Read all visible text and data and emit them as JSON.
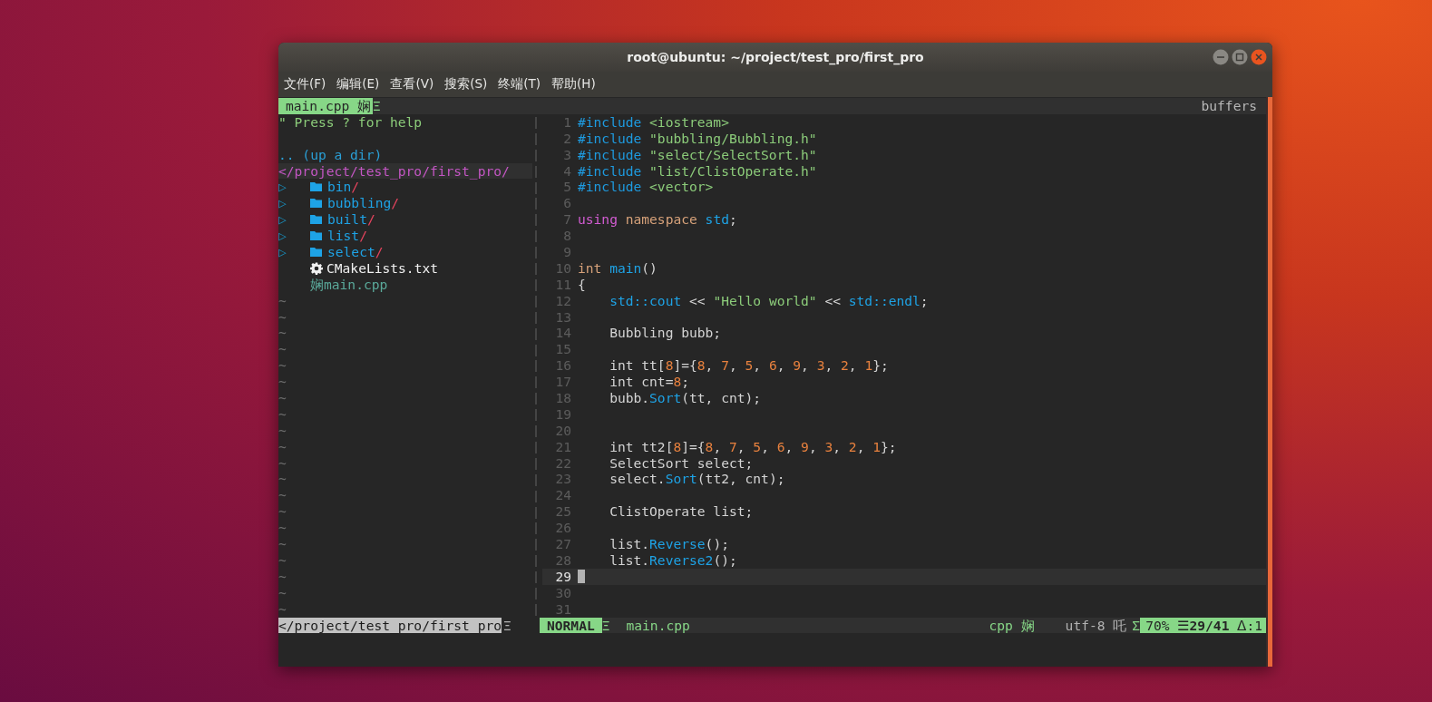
{
  "window": {
    "title": "root@ubuntu: ~/project/test_pro/first_pro"
  },
  "menu": [
    "文件(F)",
    "编辑(E)",
    "查看(V)",
    "搜索(S)",
    "终端(T)",
    "帮助(H)"
  ],
  "tabline": {
    "tab": {
      "label": "main.cpp",
      "glyph": "娴",
      "selected": true
    },
    "separator": "Ξ",
    "right": "buffers"
  },
  "tree": {
    "help": "\" Press ? for help",
    "updir": ".. (up a dir)",
    "cwd": "</project/test_pro/first_pro/",
    "entries": [
      {
        "kind": "dir",
        "arrow": "▷",
        "name": "bin",
        "suffix": "/"
      },
      {
        "kind": "dir",
        "arrow": "▷",
        "name": "bubbling",
        "suffix": "/"
      },
      {
        "kind": "dir",
        "arrow": "▷",
        "name": "built",
        "suffix": "/"
      },
      {
        "kind": "dir",
        "arrow": "▷",
        "name": "list",
        "suffix": "/"
      },
      {
        "kind": "dir",
        "arrow": "▷",
        "name": "select",
        "suffix": "/"
      },
      {
        "kind": "config",
        "name": "CMakeLists.txt"
      },
      {
        "kind": "file",
        "glyph": "娴",
        "name": "main.cpp"
      }
    ],
    "fillers": [
      "~",
      "~",
      "~",
      "~",
      "~",
      "~",
      "~",
      "~",
      "~",
      "~",
      "~",
      "~",
      "~",
      "~",
      "~",
      "~",
      "~",
      "~",
      "~",
      "~"
    ]
  },
  "code": {
    "lines": [
      {
        "n": "1",
        "current": false,
        "tokens": [
          {
            "kind": "pre",
            "text": "#include "
          },
          {
            "kind": "str",
            "text": "<iostream>"
          }
        ]
      },
      {
        "n": "2",
        "current": false,
        "tokens": [
          {
            "kind": "pre",
            "text": "#include "
          },
          {
            "kind": "str",
            "text": "\"bubbling/Bubbling.h\""
          }
        ]
      },
      {
        "n": "3",
        "current": false,
        "tokens": [
          {
            "kind": "pre",
            "text": "#include "
          },
          {
            "kind": "str",
            "text": "\"select/SelectSort.h\""
          }
        ]
      },
      {
        "n": "4",
        "current": false,
        "tokens": [
          {
            "kind": "pre",
            "text": "#include "
          },
          {
            "kind": "str",
            "text": "\"list/ClistOperate.h\""
          }
        ]
      },
      {
        "n": "5",
        "current": false,
        "tokens": [
          {
            "kind": "pre",
            "text": "#include "
          },
          {
            "kind": "str",
            "text": "<vector>"
          }
        ]
      },
      {
        "n": "6",
        "current": false
      },
      {
        "n": "7",
        "current": false,
        "tokens": [
          {
            "kind": "kw",
            "text": "using "
          },
          {
            "kind": "type",
            "text": "namespace "
          },
          {
            "kind": "fn",
            "text": "std"
          },
          {
            "kind": "plain",
            "text": ";"
          }
        ]
      },
      {
        "n": "8",
        "current": false
      },
      {
        "n": "9",
        "current": false
      },
      {
        "n": "10",
        "current": false,
        "tokens": [
          {
            "kind": "type",
            "text": "int "
          },
          {
            "kind": "fn",
            "text": "main"
          },
          {
            "kind": "plain",
            "text": "()"
          }
        ]
      },
      {
        "n": "11",
        "current": false,
        "tokens": [
          {
            "kind": "plain",
            "text": "{"
          }
        ]
      },
      {
        "n": "12",
        "current": false,
        "tokens": [
          {
            "kind": "fn",
            "text": "    std::cout"
          },
          {
            "kind": "plain",
            "text": " << "
          },
          {
            "kind": "str",
            "text": "\"Hello world\""
          },
          {
            "kind": "plain",
            "text": " << "
          },
          {
            "kind": "fn",
            "text": "std::endl"
          },
          {
            "kind": "plain",
            "text": ";"
          }
        ]
      },
      {
        "n": "13",
        "current": false
      },
      {
        "n": "14",
        "current": false,
        "tokens": [
          {
            "kind": "plain",
            "text": "    Bubbling bubb;"
          }
        ]
      },
      {
        "n": "15",
        "current": false
      },
      {
        "n": "16",
        "current": false,
        "tokens": [
          {
            "kind": "plain",
            "text": "    int tt["
          },
          {
            "kind": "num",
            "text": "8"
          },
          {
            "kind": "plain",
            "text": "]={"
          },
          {
            "kind": "num",
            "text": "8"
          },
          {
            "kind": "plain",
            "text": ", "
          },
          {
            "kind": "num",
            "text": "7"
          },
          {
            "kind": "plain",
            "text": ", "
          },
          {
            "kind": "num",
            "text": "5"
          },
          {
            "kind": "plain",
            "text": ", "
          },
          {
            "kind": "num",
            "text": "6"
          },
          {
            "kind": "plain",
            "text": ", "
          },
          {
            "kind": "num",
            "text": "9"
          },
          {
            "kind": "plain",
            "text": ", "
          },
          {
            "kind": "num",
            "text": "3"
          },
          {
            "kind": "plain",
            "text": ", "
          },
          {
            "kind": "num",
            "text": "2"
          },
          {
            "kind": "plain",
            "text": ", "
          },
          {
            "kind": "num",
            "text": "1"
          },
          {
            "kind": "plain",
            "text": "};"
          }
        ]
      },
      {
        "n": "17",
        "current": false,
        "tokens": [
          {
            "kind": "plain",
            "text": "    int cnt="
          },
          {
            "kind": "num",
            "text": "8"
          },
          {
            "kind": "plain",
            "text": ";"
          }
        ]
      },
      {
        "n": "18",
        "current": false,
        "tokens": [
          {
            "kind": "plain",
            "text": "    bubb."
          },
          {
            "kind": "fn",
            "text": "Sort"
          },
          {
            "kind": "plain",
            "text": "(tt, cnt);"
          }
        ]
      },
      {
        "n": "19",
        "current": false
      },
      {
        "n": "20",
        "current": false
      },
      {
        "n": "21",
        "current": false,
        "tokens": [
          {
            "kind": "plain",
            "text": "    int tt2["
          },
          {
            "kind": "num",
            "text": "8"
          },
          {
            "kind": "plain",
            "text": "]={"
          },
          {
            "kind": "num",
            "text": "8"
          },
          {
            "kind": "plain",
            "text": ", "
          },
          {
            "kind": "num",
            "text": "7"
          },
          {
            "kind": "plain",
            "text": ", "
          },
          {
            "kind": "num",
            "text": "5"
          },
          {
            "kind": "plain",
            "text": ", "
          },
          {
            "kind": "num",
            "text": "6"
          },
          {
            "kind": "plain",
            "text": ", "
          },
          {
            "kind": "num",
            "text": "9"
          },
          {
            "kind": "plain",
            "text": ", "
          },
          {
            "kind": "num",
            "text": "3"
          },
          {
            "kind": "plain",
            "text": ", "
          },
          {
            "kind": "num",
            "text": "2"
          },
          {
            "kind": "plain",
            "text": ", "
          },
          {
            "kind": "num",
            "text": "1"
          },
          {
            "kind": "plain",
            "text": "};"
          }
        ]
      },
      {
        "n": "22",
        "current": false,
        "tokens": [
          {
            "kind": "plain",
            "text": "    SelectSort select;"
          }
        ]
      },
      {
        "n": "23",
        "current": false,
        "tokens": [
          {
            "kind": "plain",
            "text": "    select."
          },
          {
            "kind": "fn",
            "text": "Sort"
          },
          {
            "kind": "plain",
            "text": "(tt2, cnt);"
          }
        ]
      },
      {
        "n": "24",
        "current": false
      },
      {
        "n": "25",
        "current": false,
        "tokens": [
          {
            "kind": "plain",
            "text": "    ClistOperate list;"
          }
        ]
      },
      {
        "n": "26",
        "current": false
      },
      {
        "n": "27",
        "current": false,
        "tokens": [
          {
            "kind": "plain",
            "text": "    list."
          },
          {
            "kind": "fn",
            "text": "Reverse"
          },
          {
            "kind": "plain",
            "text": "();"
          }
        ]
      },
      {
        "n": "28",
        "current": false,
        "tokens": [
          {
            "kind": "plain",
            "text": "    list."
          },
          {
            "kind": "fn",
            "text": "Reverse2"
          },
          {
            "kind": "plain",
            "text": "();"
          }
        ]
      },
      {
        "n": "29",
        "current": true
      },
      {
        "n": "30",
        "current": false
      },
      {
        "n": "31",
        "current": false
      }
    ]
  },
  "statusline": {
    "path": "</project/test_pro/first_pro",
    "path_separator": "Ξ",
    "mode": "NORMAL",
    "mode_separator": "Ξ",
    "filename": "main.cpp",
    "filetype": "cpp 娴",
    "encoding": "utf-8 吒",
    "segment_separator": "Σ",
    "percent": "70%",
    "line_glyph": "☰",
    "position": "29/41",
    "column": "ᐃ:1"
  }
}
